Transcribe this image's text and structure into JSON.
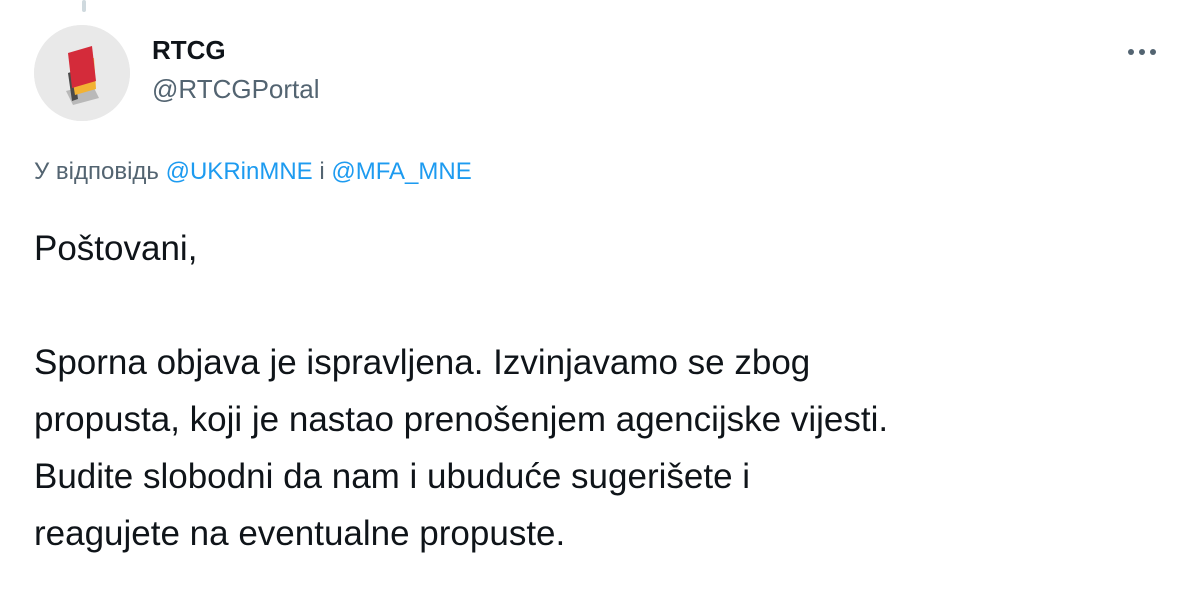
{
  "author": {
    "name": "RTCG",
    "handle": "@RTCGPortal",
    "avatar_icon": "rtcg-logo-icon"
  },
  "menu": {
    "icon": "more-horizontal-icon"
  },
  "reply": {
    "prefix": "У відповідь",
    "mention_1": "@UKRinMNE",
    "connector": "і",
    "mention_2": "@MFA_MNE"
  },
  "tweet": {
    "greeting": "Poštovani,",
    "lines": [
      "Sporna objava je ispravljena. Izvinjavamo se zbog",
      "propusta, koji je nastao prenošenjem agencijske vijesti.",
      "Budite slobodni da nam i ubuduće sugerišete i",
      "reagujete na eventualne propuste."
    ]
  },
  "colors": {
    "text_primary": "#0f1419",
    "text_secondary": "#536471",
    "link": "#1d9bf0",
    "thread_line": "#cfd9de"
  }
}
